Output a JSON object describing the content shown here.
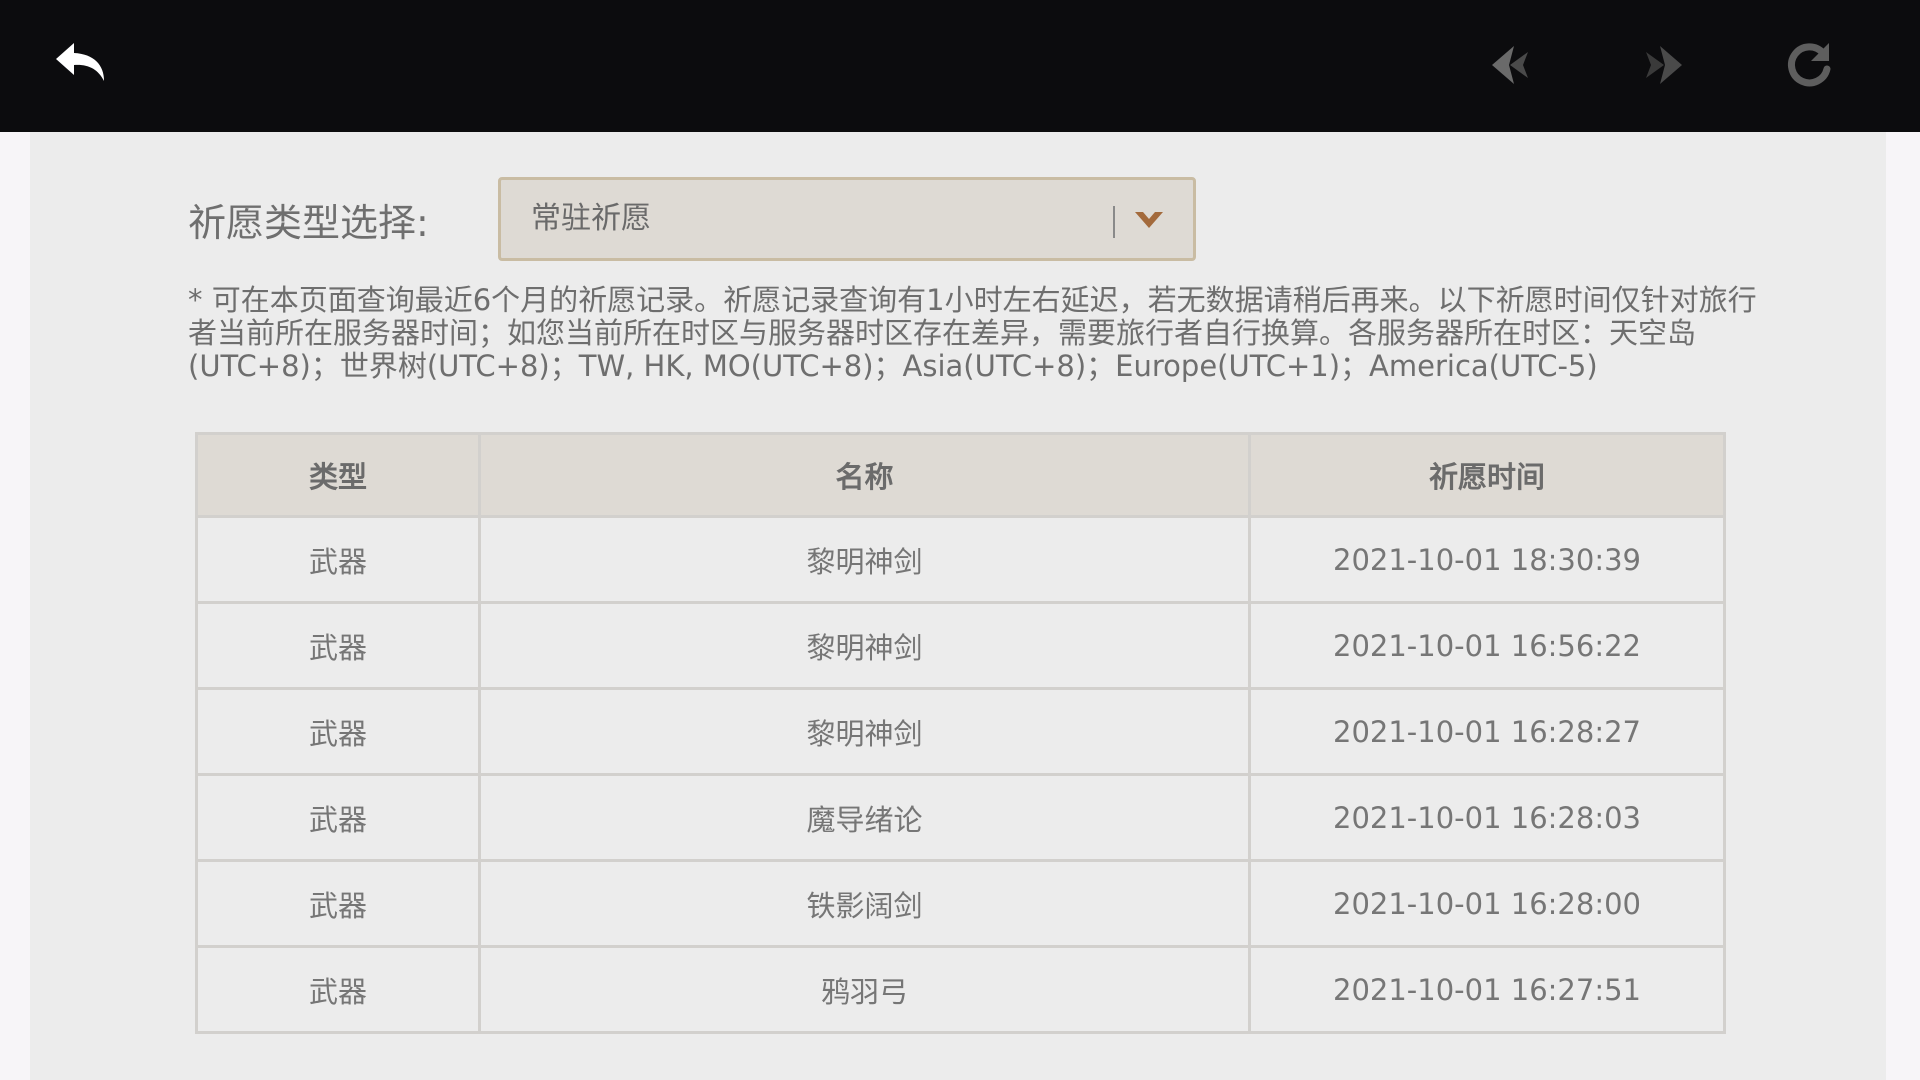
{
  "header": {
    "back_icon": "back-arrow-icon",
    "prev_icon": "nav-back-icon",
    "forward_icon": "nav-forward-icon",
    "refresh_icon": "refresh-icon"
  },
  "filter": {
    "label": "祈愿类型选择:",
    "selected": "常驻祈愿",
    "dropdown_icon": "chevron-down-icon"
  },
  "notice": "* 可在本页面查询最近6个月的祈愿记录。祈愿记录查询有1小时左右延迟，若无数据请稍后再来。以下祈愿时间仅针对旅行者当前所在服务器时间；如您当前所在时区与服务器时区存在差异，需要旅行者自行换算。各服务器所在时区：天空岛(UTC+8)；世界树(UTC+8)；TW, HK, MO(UTC+8)；Asia(UTC+8)；Europe(UTC+1)；America(UTC-5)",
  "table": {
    "headers": [
      "类型",
      "名称",
      "祈愿时间"
    ],
    "rows": [
      [
        "武器",
        "黎明神剑",
        "2021-10-01 18:30:39"
      ],
      [
        "武器",
        "黎明神剑",
        "2021-10-01 16:56:22"
      ],
      [
        "武器",
        "黎明神剑",
        "2021-10-01 16:28:27"
      ],
      [
        "武器",
        "魔导绪论",
        "2021-10-01 16:28:03"
      ],
      [
        "武器",
        "铁影阔剑",
        "2021-10-01 16:28:00"
      ],
      [
        "武器",
        "鸦羽弓",
        "2021-10-01 16:27:51"
      ]
    ]
  },
  "colors": {
    "topbar": "#0c0c0e",
    "panel": "#ececec",
    "accent": "#c9a464",
    "header_cell": "#dedad4"
  }
}
